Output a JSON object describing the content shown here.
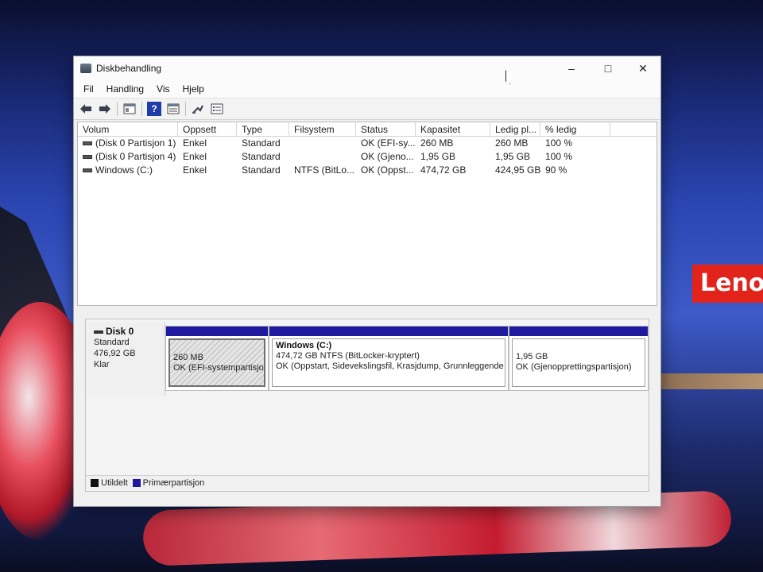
{
  "window": {
    "title": "Diskbehandling",
    "controls": {
      "minimize": "–",
      "maximize": "□",
      "close": "✕"
    }
  },
  "menu": [
    "Fil",
    "Handling",
    "Vis",
    "Hjelp"
  ],
  "toolbar": {
    "icons": [
      "back-arrow-icon",
      "forward-arrow-icon",
      "console-tree-icon",
      "help-icon",
      "properties-icon",
      "rescan-icon",
      "list-view-icon"
    ],
    "help_label": "?"
  },
  "volumes": {
    "columns": [
      "Volum",
      "Oppsett",
      "Type",
      "Filsystem",
      "Status",
      "Kapasitet",
      "Ledig pl...",
      "% ledig"
    ],
    "rows": [
      [
        "(Disk 0 Partisjon 1)",
        "Enkel",
        "Standard",
        "",
        "OK (EFI-sy...",
        "260 MB",
        "260 MB",
        "100 %"
      ],
      [
        "(Disk 0 Partisjon 4)",
        "Enkel",
        "Standard",
        "",
        "OK (Gjeno...",
        "1,95 GB",
        "1,95 GB",
        "100 %"
      ],
      [
        "Windows (C:)",
        "Enkel",
        "Standard",
        "NTFS (BitLo...",
        "OK (Oppst...",
        "474,72 GB",
        "424,95 GB",
        "90 %"
      ]
    ]
  },
  "disk": {
    "name": "Disk 0",
    "type": "Standard",
    "size": "476,92 GB",
    "status": "Klar"
  },
  "partitions": [
    {
      "name": "",
      "size": "260 MB",
      "status": "OK (EFI-systempartisjo"
    },
    {
      "name": "Windows  (C:)",
      "size": "474,72 GB NTFS (BitLocker-kryptert)",
      "status": "OK (Oppstart, Sidevekslingsfil, Krasjdump, Grunnleggende"
    },
    {
      "name": "",
      "size": "1,95 GB",
      "status": "OK (Gjenopprettingspartisjon)"
    }
  ],
  "legend": [
    {
      "label": "Utildelt",
      "color": "#111111"
    },
    {
      "label": "Primærpartisjon",
      "color": "#1d1aa0"
    }
  ],
  "wallpaper": {
    "brand": "Leno"
  }
}
